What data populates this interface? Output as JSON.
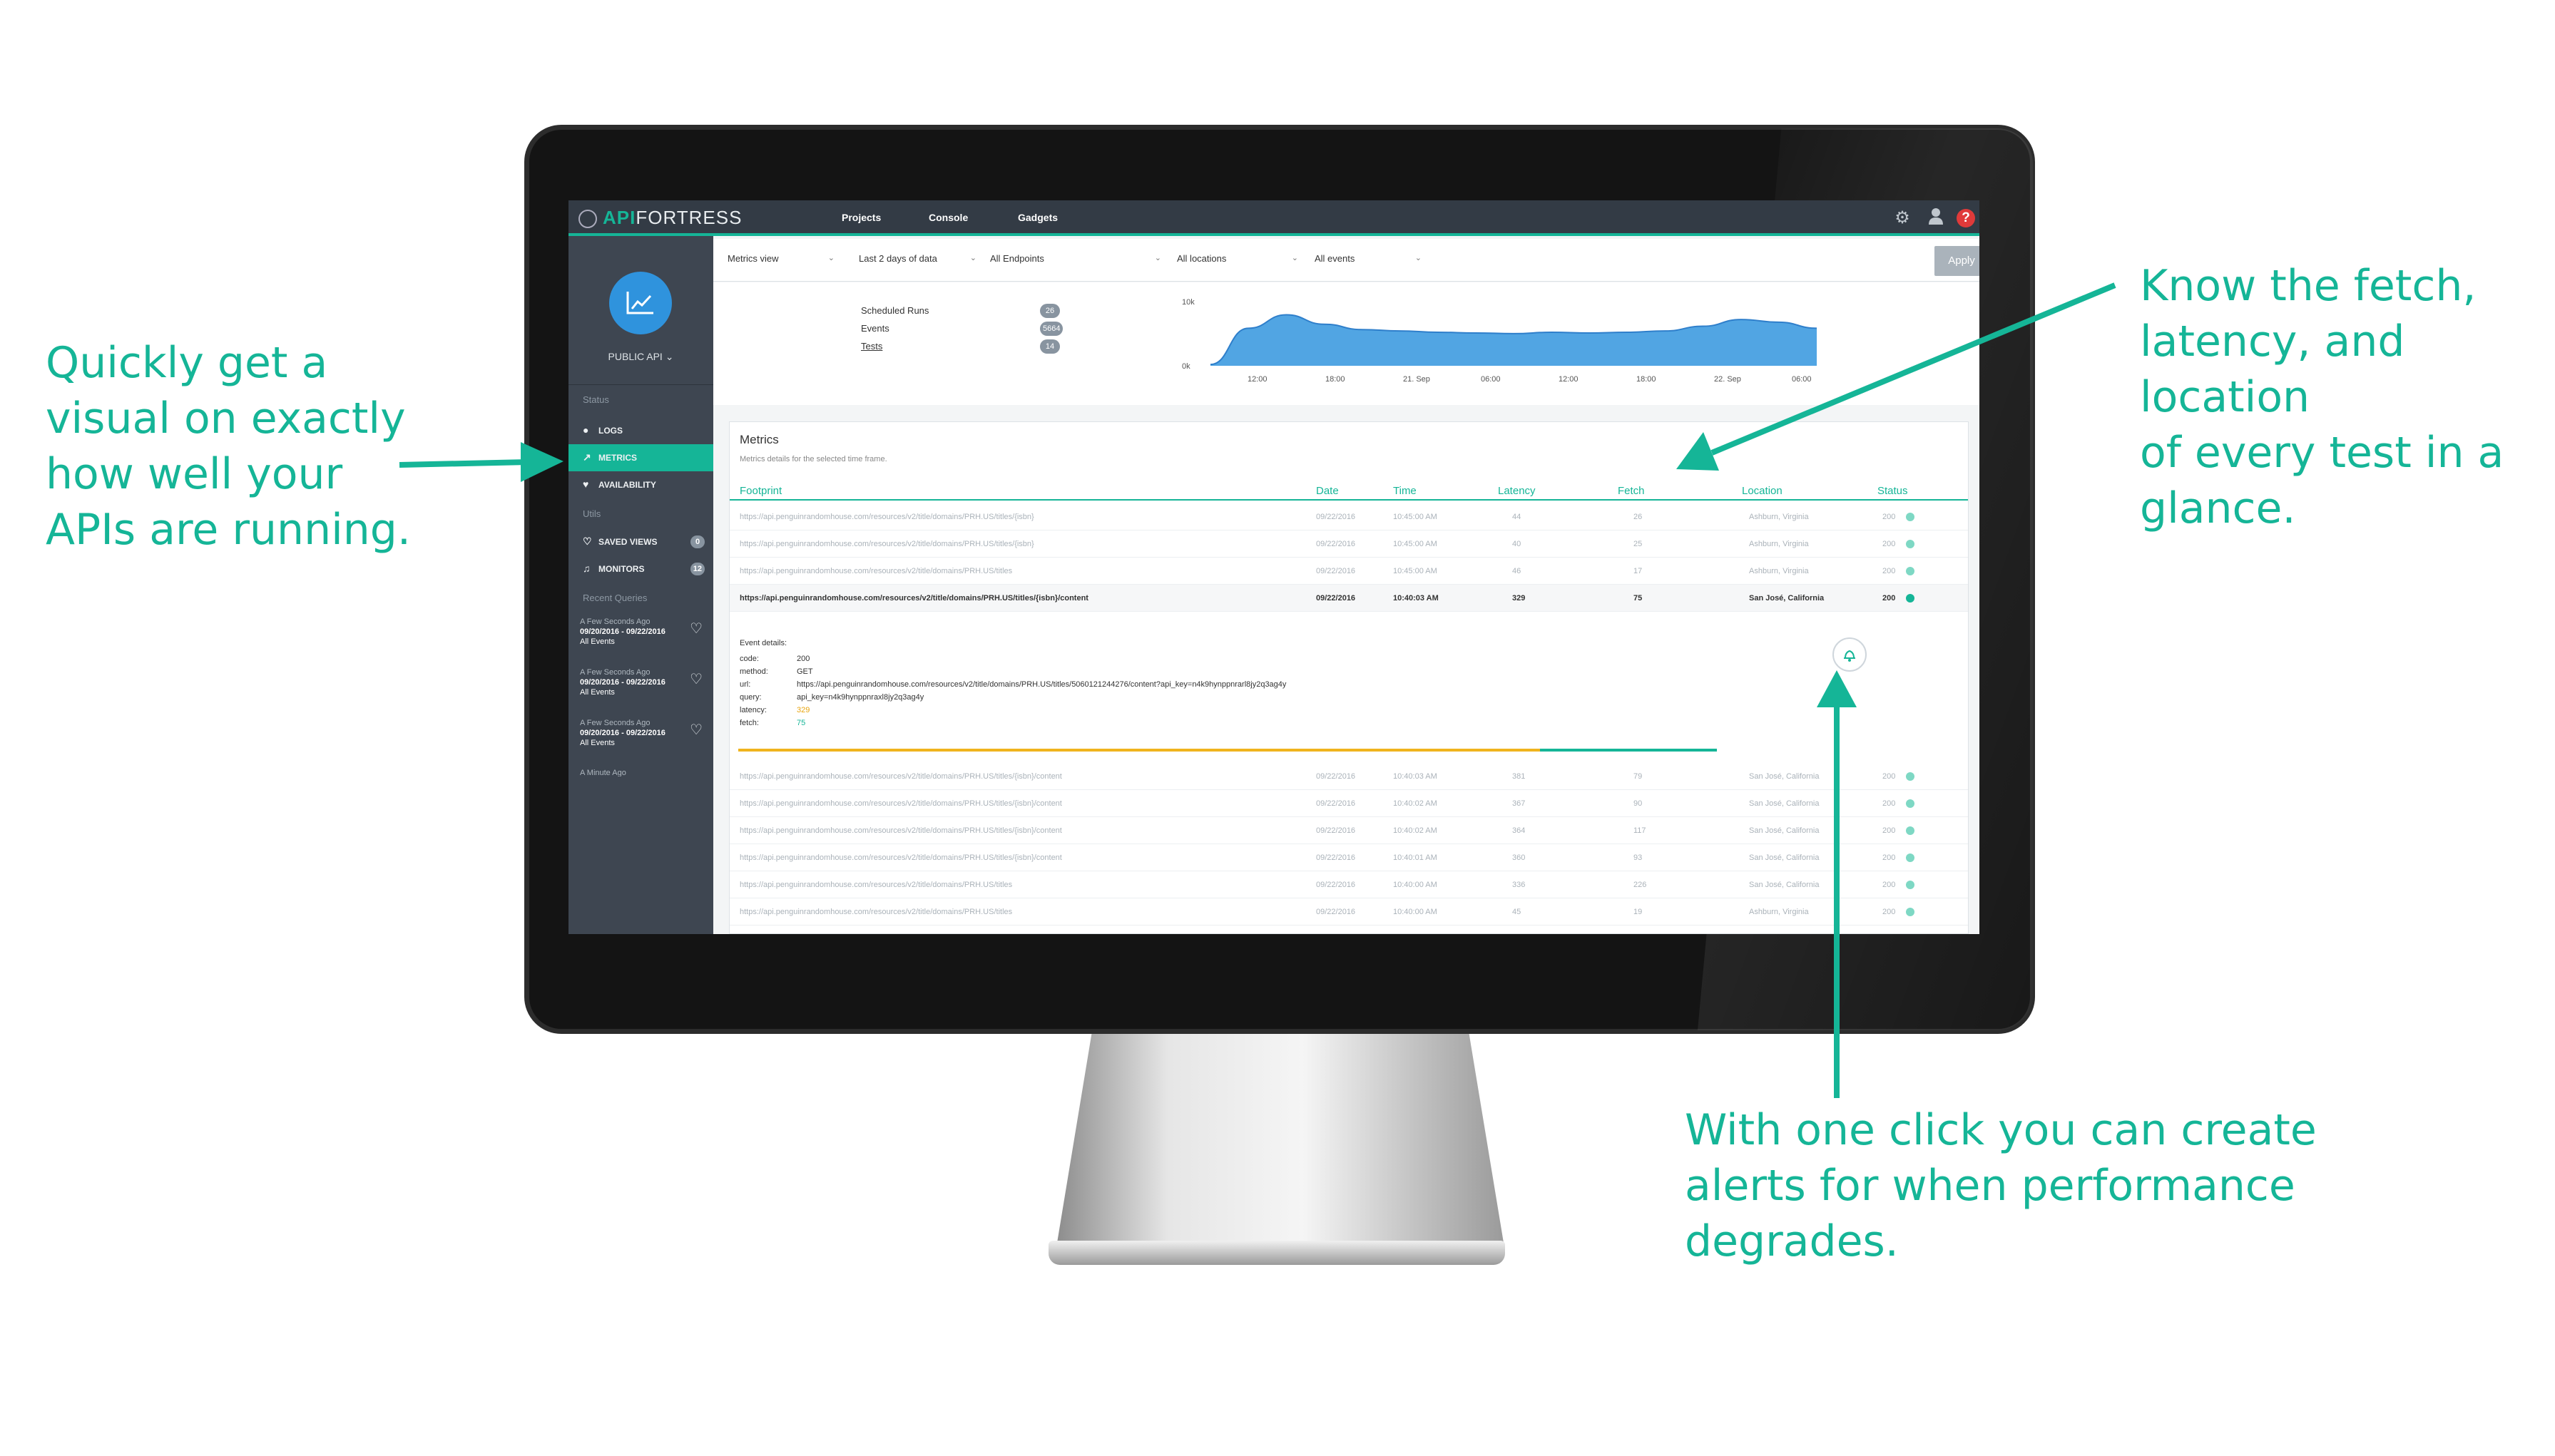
{
  "callouts": {
    "left": [
      "Quickly get a",
      "visual on exactly",
      "how well your",
      "APIs are running."
    ],
    "right": [
      "Know the fetch,",
      "latency, and location",
      "of every test in a",
      "glance."
    ],
    "bottom": [
      "With one click you can create",
      "alerts for when performance",
      "degrades."
    ]
  },
  "app": {
    "logo_accent": "API",
    "logo_rest": "FORTRESS",
    "nav": [
      "Projects",
      "Console",
      "Gadgets"
    ]
  },
  "sidebar": {
    "project": "PUBLIC API",
    "status_heading": "Status",
    "status_items": [
      "LOGS",
      "METRICS",
      "AVAILABILITY"
    ],
    "utils_heading": "Utils",
    "saved_views": {
      "label": "SAVED VIEWS",
      "count": "0"
    },
    "monitors": {
      "label": "MONITORS",
      "count": "12"
    },
    "recent_heading": "Recent Queries",
    "recent": [
      {
        "time": "A Few Seconds Ago",
        "range": "09/20/2016 - 09/22/2016",
        "type": "All Events"
      },
      {
        "time": "A Few Seconds Ago",
        "range": "09/20/2016 - 09/22/2016",
        "type": "All Events"
      },
      {
        "time": "A Few Seconds Ago",
        "range": "09/20/2016 - 09/22/2016",
        "type": "All Events"
      },
      {
        "time": "A Minute Ago"
      }
    ]
  },
  "filters": {
    "view": "Metrics view",
    "range": "Last 2 days of data",
    "endpoints": "All Endpoints",
    "locations": "All locations",
    "events": "All events",
    "apply": "Apply"
  },
  "summary": {
    "scheduled_runs": {
      "label": "Scheduled Runs",
      "value": "26"
    },
    "events": {
      "label": "Events",
      "value": "5664"
    },
    "tests": {
      "label": "Tests",
      "value": "14"
    }
  },
  "chart_data": {
    "type": "area",
    "y_ticks": [
      "10k",
      "0k"
    ],
    "x_ticks": [
      "12:00",
      "18:00",
      "21. Sep",
      "06:00",
      "12:00",
      "18:00",
      "22. Sep",
      "06:00"
    ],
    "x": [
      0,
      1,
      2,
      3,
      4,
      5,
      6,
      7,
      8,
      9,
      10,
      11,
      12,
      13,
      14,
      15,
      16
    ],
    "values": [
      200,
      5600,
      7600,
      6200,
      5400,
      5200,
      5000,
      4900,
      4800,
      5000,
      4900,
      5000,
      5200,
      5900,
      6900,
      6500,
      5600
    ],
    "ylim": [
      0,
      10000
    ],
    "color": "#3e9be0"
  },
  "metrics": {
    "title": "Metrics",
    "subtitle": "Metrics details for the selected time frame.",
    "columns": [
      "Footprint",
      "Date",
      "Time",
      "Latency",
      "Fetch",
      "Location",
      "Status"
    ],
    "rows_top": [
      [
        "https://api.penguinrandomhouse.com/resources/v2/title/domains/PRH.US/titles/{isbn}",
        "09/22/2016",
        "10:45:00 AM",
        "44",
        "26",
        "Ashburn, Virginia",
        "200"
      ],
      [
        "https://api.penguinrandomhouse.com/resources/v2/title/domains/PRH.US/titles/{isbn}",
        "09/22/2016",
        "10:45:00 AM",
        "40",
        "25",
        "Ashburn, Virginia",
        "200"
      ],
      [
        "https://api.penguinrandomhouse.com/resources/v2/title/domains/PRH.US/titles",
        "09/22/2016",
        "10:45:00 AM",
        "46",
        "17",
        "Ashburn, Virginia",
        "200"
      ],
      [
        "https://api.penguinrandomhouse.com/resources/v2/title/domains/PRH.US/titles/{isbn}/content",
        "09/22/2016",
        "10:40:03 AM",
        "329",
        "75",
        "San José, California",
        "200"
      ]
    ],
    "details": {
      "heading": "Event details:",
      "fields": [
        {
          "k": "code:",
          "v": "200"
        },
        {
          "k": "method:",
          "v": "GET"
        },
        {
          "k": "url:",
          "v": "https://api.penguinrandomhouse.com/resources/v2/title/domains/PRH.US/titles/5060121244276/content?api_key=n4k9hynppnrarl8jy2q3ag4y"
        },
        {
          "k": "query:",
          "v": "api_key=n4k9hynppnraxl8jy2q3ag4y"
        },
        {
          "k": "latency:",
          "v": "329"
        },
        {
          "k": "fetch:",
          "v": "75"
        }
      ]
    },
    "rows_bottom": [
      [
        "https://api.penguinrandomhouse.com/resources/v2/title/domains/PRH.US/titles/{isbn}/content",
        "09/22/2016",
        "10:40:03 AM",
        "381",
        "79",
        "San José, California",
        "200"
      ],
      [
        "https://api.penguinrandomhouse.com/resources/v2/title/domains/PRH.US/titles/{isbn}/content",
        "09/22/2016",
        "10:40:02 AM",
        "367",
        "90",
        "San José, California",
        "200"
      ],
      [
        "https://api.penguinrandomhouse.com/resources/v2/title/domains/PRH.US/titles/{isbn}/content",
        "09/22/2016",
        "10:40:02 AM",
        "364",
        "117",
        "San José, California",
        "200"
      ],
      [
        "https://api.penguinrandomhouse.com/resources/v2/title/domains/PRH.US/titles/{isbn}/content",
        "09/22/2016",
        "10:40:01 AM",
        "360",
        "93",
        "San José, California",
        "200"
      ],
      [
        "https://api.penguinrandomhouse.com/resources/v2/title/domains/PRH.US/titles",
        "09/22/2016",
        "10:40:00 AM",
        "336",
        "226",
        "San José, California",
        "200"
      ],
      [
        "https://api.penguinrandomhouse.com/resources/v2/title/domains/PRH.US/titles",
        "09/22/2016",
        "10:40:00 AM",
        "45",
        "19",
        "Ashburn, Virginia",
        "200"
      ]
    ]
  }
}
